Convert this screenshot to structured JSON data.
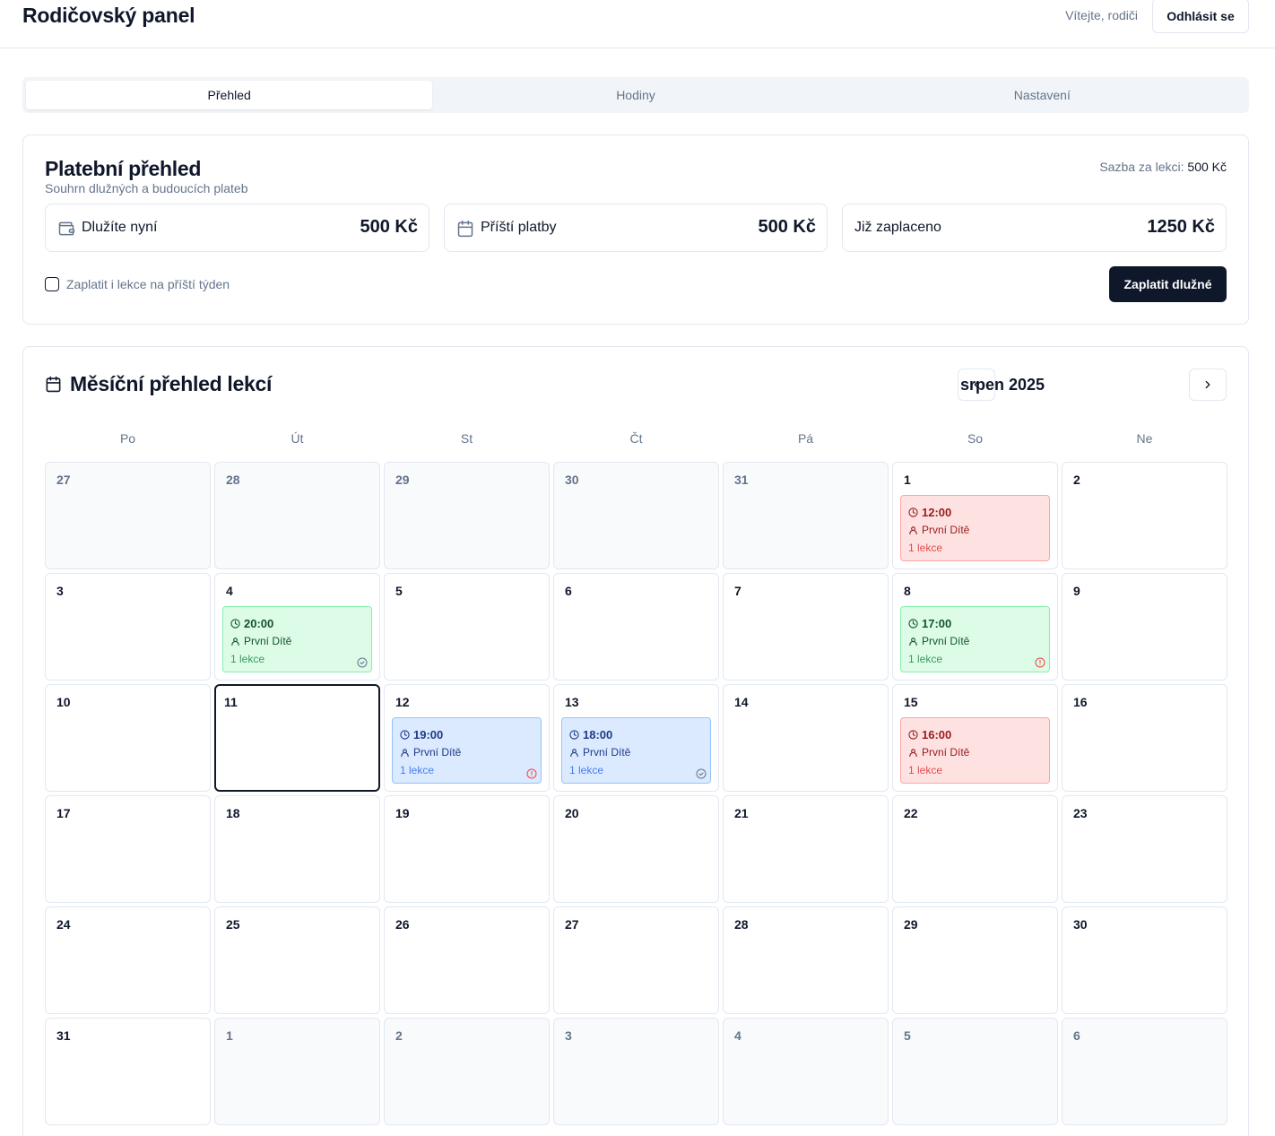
{
  "header": {
    "title": "Rodičovský panel",
    "welcome": "Vítejte, rodiči",
    "logout_label": "Odhlásit se"
  },
  "tabs": [
    {
      "label": "Přehled",
      "active": true
    },
    {
      "label": "Hodiny",
      "active": false
    },
    {
      "label": "Nastavení",
      "active": false
    }
  ],
  "payments": {
    "title": "Platební přehled",
    "subtitle": "Souhrn dlužných a budoucích plateb",
    "rate_label": "Sazba za lekci:",
    "rate_value": "500 Kč",
    "stats": [
      {
        "label": "Dlužíte nyní",
        "value": "500 Kč",
        "icon": "wallet-icon"
      },
      {
        "label": "Příští platby",
        "value": "500 Kč",
        "icon": "calendar-icon"
      },
      {
        "label": "Již zaplaceno",
        "value": "1250 Kč",
        "icon": ""
      }
    ],
    "checkbox_label": "Zaplatit i lekce na příští týden",
    "checkbox_checked": false,
    "pay_button": "Zaplatit dlužné"
  },
  "calendar": {
    "title": "Měsíční přehled lekcí",
    "month": "srpen 2025",
    "weekdays": [
      "Po",
      "Út",
      "St",
      "Čt",
      "Pá",
      "So",
      "Ne"
    ],
    "days": [
      {
        "n": "27",
        "other": true
      },
      {
        "n": "28",
        "other": true
      },
      {
        "n": "29",
        "other": true
      },
      {
        "n": "30",
        "other": true
      },
      {
        "n": "31",
        "other": true
      },
      {
        "n": "1",
        "lesson": {
          "time": "12:00",
          "child": "První Dítě",
          "count": "1 lekce",
          "color": "red",
          "status": ""
        }
      },
      {
        "n": "2"
      },
      {
        "n": "3"
      },
      {
        "n": "4",
        "lesson": {
          "time": "20:00",
          "child": "První Dítě",
          "count": "1 lekce",
          "color": "green",
          "status": "check"
        }
      },
      {
        "n": "5"
      },
      {
        "n": "6"
      },
      {
        "n": "7"
      },
      {
        "n": "8",
        "lesson": {
          "time": "17:00",
          "child": "První Dítě",
          "count": "1 lekce",
          "color": "green",
          "status": "alert"
        }
      },
      {
        "n": "9"
      },
      {
        "n": "10"
      },
      {
        "n": "11",
        "today": true
      },
      {
        "n": "12",
        "lesson": {
          "time": "19:00",
          "child": "První Dítě",
          "count": "1 lekce",
          "color": "blue",
          "status": "alert"
        }
      },
      {
        "n": "13",
        "lesson": {
          "time": "18:00",
          "child": "První Dítě",
          "count": "1 lekce",
          "color": "blue",
          "status": "check"
        }
      },
      {
        "n": "14"
      },
      {
        "n": "15",
        "lesson": {
          "time": "16:00",
          "child": "První Dítě",
          "count": "1 lekce",
          "color": "red",
          "status": ""
        }
      },
      {
        "n": "16"
      },
      {
        "n": "17"
      },
      {
        "n": "18"
      },
      {
        "n": "19"
      },
      {
        "n": "20"
      },
      {
        "n": "21"
      },
      {
        "n": "22"
      },
      {
        "n": "23"
      },
      {
        "n": "24"
      },
      {
        "n": "25"
      },
      {
        "n": "26"
      },
      {
        "n": "27"
      },
      {
        "n": "28"
      },
      {
        "n": "29"
      },
      {
        "n": "30"
      },
      {
        "n": "31"
      },
      {
        "n": "1",
        "other": true
      },
      {
        "n": "2",
        "other": true
      },
      {
        "n": "3",
        "other": true
      },
      {
        "n": "4",
        "other": true
      },
      {
        "n": "5",
        "other": true
      },
      {
        "n": "6",
        "other": true
      }
    ]
  }
}
